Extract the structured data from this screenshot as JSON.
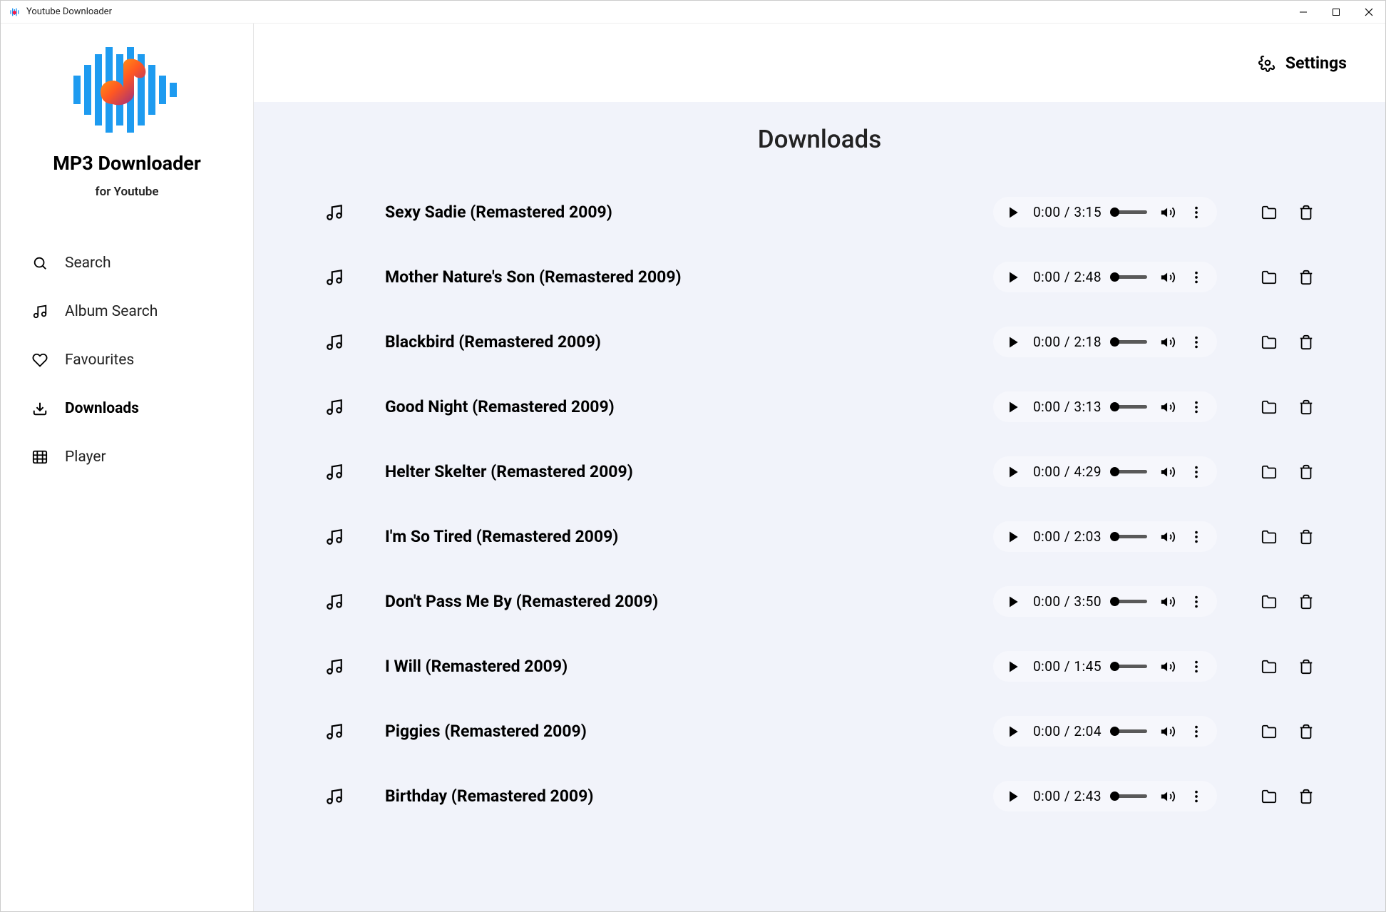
{
  "window": {
    "title": "Youtube Downloader"
  },
  "branding": {
    "name": "MP3 Downloader",
    "sub": "for Youtube"
  },
  "nav": {
    "items": [
      {
        "label": "Search"
      },
      {
        "label": "Album Search"
      },
      {
        "label": "Favourites"
      },
      {
        "label": "Downloads"
      },
      {
        "label": "Player"
      }
    ],
    "active_index": 3
  },
  "topbar": {
    "settings_label": "Settings"
  },
  "page": {
    "title": "Downloads"
  },
  "tracks": [
    {
      "title": "Sexy Sadie (Remastered 2009)",
      "current": "0:00",
      "duration": "3:15"
    },
    {
      "title": "Mother Nature's Son (Remastered 2009)",
      "current": "0:00",
      "duration": "2:48"
    },
    {
      "title": "Blackbird (Remastered 2009)",
      "current": "0:00",
      "duration": "2:18"
    },
    {
      "title": "Good Night (Remastered 2009)",
      "current": "0:00",
      "duration": "3:13"
    },
    {
      "title": "Helter Skelter (Remastered 2009)",
      "current": "0:00",
      "duration": "4:29"
    },
    {
      "title": "I'm So Tired (Remastered 2009)",
      "current": "0:00",
      "duration": "2:03"
    },
    {
      "title": "Don't Pass Me By (Remastered 2009)",
      "current": "0:00",
      "duration": "3:50"
    },
    {
      "title": "I Will (Remastered 2009)",
      "current": "0:00",
      "duration": "1:45"
    },
    {
      "title": "Piggies (Remastered 2009)",
      "current": "0:00",
      "duration": "2:04"
    },
    {
      "title": "Birthday (Remastered 2009)",
      "current": "0:00",
      "duration": "2:43"
    }
  ]
}
